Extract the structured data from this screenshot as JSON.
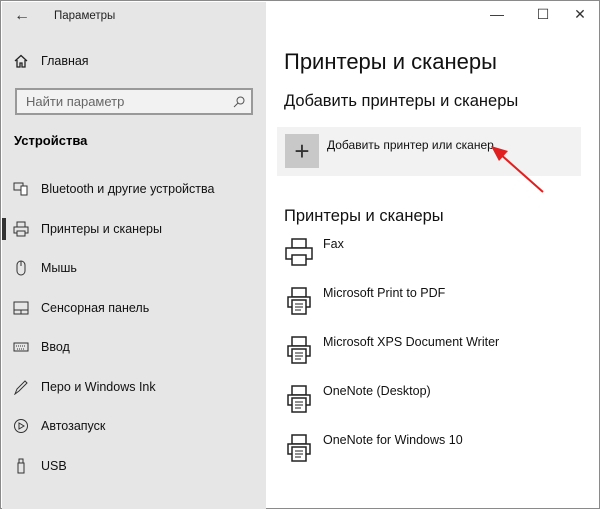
{
  "window": {
    "title": "Параметры",
    "back_icon": "arrow-left-icon",
    "minimize": "—",
    "maximize": "☐",
    "close": "✕"
  },
  "sidebar": {
    "home": "Главная",
    "search_placeholder": "Найти параметр",
    "section": "Устройства",
    "items": [
      {
        "label": "Bluetooth и другие устройства",
        "icon": "bluetooth-devices-icon"
      },
      {
        "label": "Принтеры и сканеры",
        "icon": "printer-icon",
        "active": true
      },
      {
        "label": "Мышь",
        "icon": "mouse-icon"
      },
      {
        "label": "Сенсорная панель",
        "icon": "touchpad-icon"
      },
      {
        "label": "Ввод",
        "icon": "keyboard-icon"
      },
      {
        "label": "Перо и Windows Ink",
        "icon": "pen-icon"
      },
      {
        "label": "Автозапуск",
        "icon": "autoplay-icon"
      },
      {
        "label": "USB",
        "icon": "usb-icon"
      }
    ]
  },
  "main": {
    "title": "Принтеры и сканеры",
    "add_heading": "Добавить принтеры и сканеры",
    "add_button": "Добавить принтер или сканер",
    "list_heading": "Принтеры и сканеры",
    "printers": [
      "Fax",
      "Microsoft Print to PDF",
      "Microsoft XPS Document Writer",
      "OneNote (Desktop)",
      "OneNote for Windows 10"
    ]
  },
  "colors": {
    "sidebar_bg": "#e6e6e6",
    "arrow": "#e02020"
  }
}
